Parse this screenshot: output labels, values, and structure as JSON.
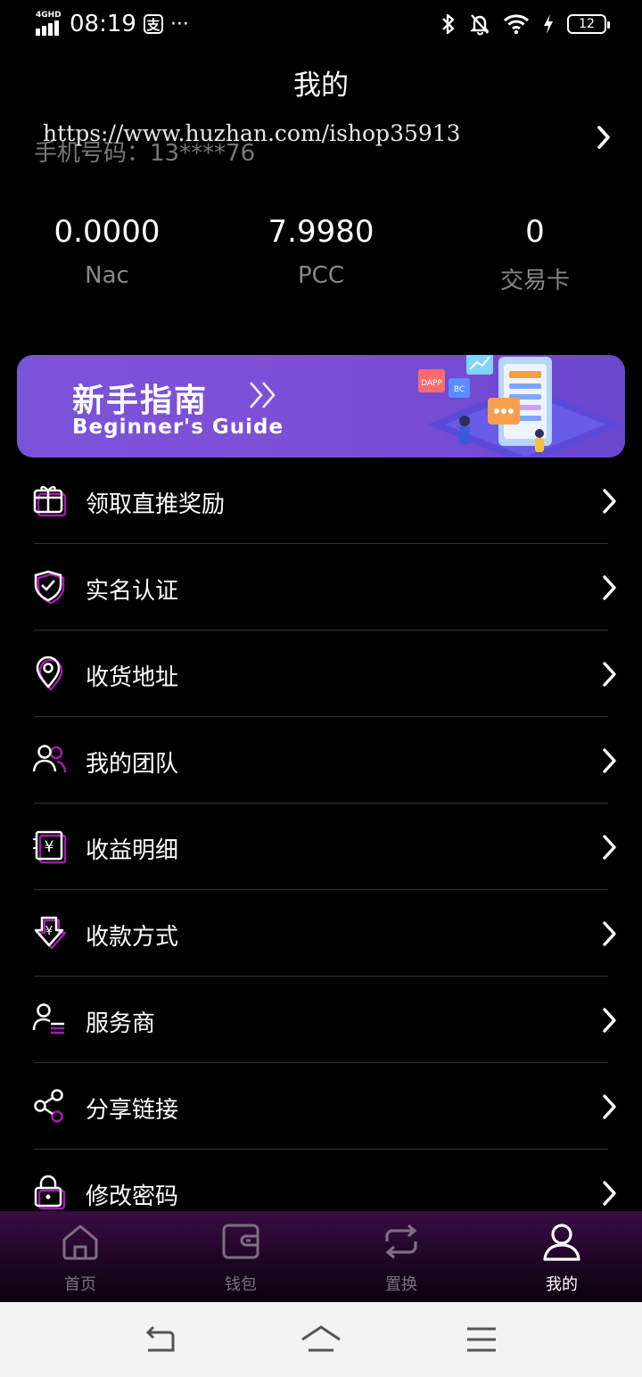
{
  "status": {
    "network": "4GHD",
    "time": "08:19",
    "alipay_glyph": "支",
    "more": "···",
    "battery": "12"
  },
  "page": {
    "title": "我的"
  },
  "account": {
    "phone": "手机号码：13****76",
    "watermark": "https://www.huzhan.com/ishop35913"
  },
  "stats": [
    {
      "value": "0.0000",
      "label": "Nac"
    },
    {
      "value": "7.9980",
      "label": "PCC"
    },
    {
      "value": "0",
      "label": "交易卡"
    }
  ],
  "banner": {
    "title_cn": "新手指南",
    "title_en": "Beginner's Guide",
    "badge_dapp": "DAPP",
    "badge_bc": "BC"
  },
  "menu": [
    {
      "label": "领取直推奖励",
      "icon": "gift-icon"
    },
    {
      "label": "实名认证",
      "icon": "shield-check-icon"
    },
    {
      "label": "收货地址",
      "icon": "location-pin-icon"
    },
    {
      "label": "我的团队",
      "icon": "team-icon"
    },
    {
      "label": "收益明细",
      "icon": "income-detail-icon"
    },
    {
      "label": "收款方式",
      "icon": "payment-method-icon"
    },
    {
      "label": "服务商",
      "icon": "service-provider-icon"
    },
    {
      "label": "分享链接",
      "icon": "share-icon"
    },
    {
      "label": "修改密码",
      "icon": "lock-icon"
    }
  ],
  "icon_glyphs": {
    "yuan": "¥"
  },
  "tabs": [
    {
      "label": "首页",
      "icon": "home-icon",
      "active": false
    },
    {
      "label": "钱包",
      "icon": "wallet-icon",
      "active": false
    },
    {
      "label": "置换",
      "icon": "exchange-icon",
      "active": false
    },
    {
      "label": "我的",
      "icon": "user-icon",
      "active": true
    }
  ],
  "colors": {
    "background": "#000000",
    "accent": "#c026d3",
    "banner": "#7b53d9",
    "tabbar": "#2a0933"
  }
}
